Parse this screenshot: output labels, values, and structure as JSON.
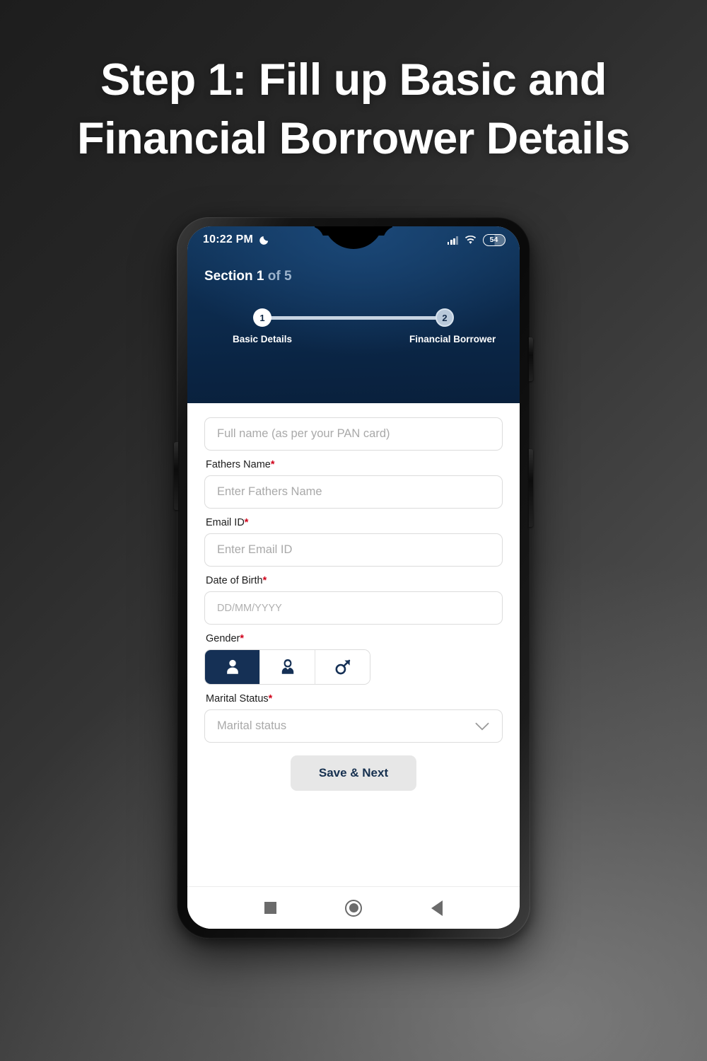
{
  "poster": {
    "headline_line1": "Step 1: Fill up Basic and",
    "headline_line2": "Financial Borrower Details"
  },
  "phone": {
    "statusbar": {
      "time": "10:22 PM",
      "moon_icon": "moon-icon",
      "signal_icon": "cellular-signal-icon",
      "wifi_icon": "wifi-icon",
      "battery_level": "54"
    },
    "header": {
      "section_prefix": "Section 1",
      "section_suffix": " of 5",
      "stepper": [
        {
          "number": "1",
          "label": "Basic Details",
          "state": "active"
        },
        {
          "number": "2",
          "label": "Financial Borrower",
          "state": "inactive"
        }
      ]
    },
    "form": {
      "fields": [
        {
          "label": "",
          "placeholder": "Full name (as per your PAN card)",
          "required": false,
          "type": "text"
        },
        {
          "label": "Fathers Name",
          "placeholder": "Enter Fathers Name",
          "required": true,
          "type": "text"
        },
        {
          "label": "Email ID",
          "placeholder": "Enter Email ID",
          "required": true,
          "type": "text"
        },
        {
          "label": "Date of Birth",
          "placeholder": "DD/MM/YYYY",
          "required": true,
          "type": "date"
        },
        {
          "label": "Gender",
          "placeholder": "",
          "required": true,
          "type": "segmented"
        },
        {
          "label": "Marital Status",
          "placeholder": "Marital status",
          "required": true,
          "type": "select"
        }
      ],
      "gender_options": [
        {
          "icon": "male-person-icon",
          "selected": true
        },
        {
          "icon": "female-person-icon",
          "selected": false
        },
        {
          "icon": "mars-symbol-icon",
          "selected": false
        }
      ],
      "submit_label": "Save & Next"
    },
    "navbar": {
      "recents_icon": "square-recents-icon",
      "home_icon": "circle-home-icon",
      "back_icon": "triangle-back-icon"
    }
  },
  "colors": {
    "header_navy": "#0d2c4f",
    "accent_navy": "#153055",
    "required_red": "#d0021b",
    "button_bg": "#e7e7e7",
    "stepper_track": "#c7d4e2"
  }
}
